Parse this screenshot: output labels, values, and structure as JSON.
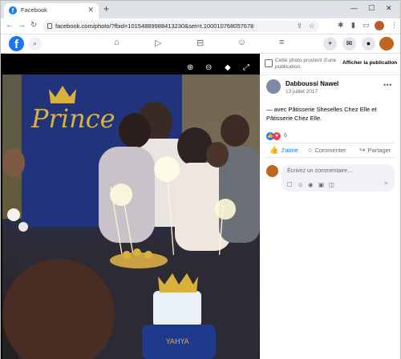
{
  "browser": {
    "tab_title": "Facebook",
    "tab_favicon": "f",
    "url": "facebook.com/photo/?fbid=10154889988413230&set=t.100010768057678",
    "window_controls": {
      "minimize": "—",
      "maximize": "☐",
      "close": "✕"
    }
  },
  "facebook_header": {
    "logo": "f",
    "nav_icons": [
      "home-icon",
      "watch-icon",
      "marketplace-icon",
      "groups-icon",
      "menu-icon"
    ]
  },
  "photo": {
    "banner_text": "Prince",
    "cake_text": "YAHYA"
  },
  "panel": {
    "notice": "Cette photo provient d’une publication.",
    "show_publication": "Afficher la publication",
    "author": "Dabboussi Nawel",
    "date": "13 juillet 2017",
    "caption": "— avec Pâtisserie Sheselles Chez Elle et Pâtisserie Chez Elle.",
    "reaction_count": "6",
    "actions": {
      "like": "J’aime",
      "comment": "Commenter",
      "share": "Partager"
    },
    "comment_placeholder": "Écrivez un commentaire…"
  },
  "colors": {
    "fb_blue": "#1877f2",
    "love_red": "#f33e58",
    "banner_blue": "#1c2b6e",
    "gold": "#d8b23a"
  }
}
